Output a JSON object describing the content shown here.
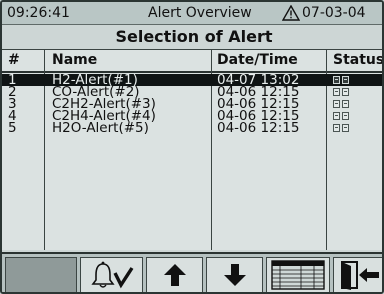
{
  "header": {
    "time": "09:26:41",
    "title": "Alert Overview",
    "date": "07-03-04"
  },
  "subtitle": "Selection of Alert",
  "table": {
    "columns": [
      "#",
      "Name",
      "Date/Time",
      "Status"
    ],
    "rows": [
      {
        "num": "1",
        "name": "H2-Alert(#1)",
        "datetime": "04-07 13:02",
        "selected": true
      },
      {
        "num": "2",
        "name": "CO-Alert(#2)",
        "datetime": "04-06 12:15",
        "selected": false
      },
      {
        "num": "3",
        "name": "C2H2-Alert(#3)",
        "datetime": "04-06 12:15",
        "selected": false
      },
      {
        "num": "4",
        "name": "C2H4-Alert(#4)",
        "datetime": "04-06 12:15",
        "selected": false
      },
      {
        "num": "5",
        "name": "H2O-Alert(#5)",
        "datetime": "04-06 12:15",
        "selected": false
      }
    ]
  },
  "icons": {
    "warning": "warning-triangle-icon",
    "status": "status-icon",
    "acknowledge": "bell-acknowledge-icon",
    "up": "arrow-up-icon",
    "down": "arrow-down-icon",
    "table_view": "table-view-icon",
    "exit": "exit-door-icon"
  },
  "colors": {
    "selected_row": "#0f1414",
    "background": "#cdd6d5"
  }
}
